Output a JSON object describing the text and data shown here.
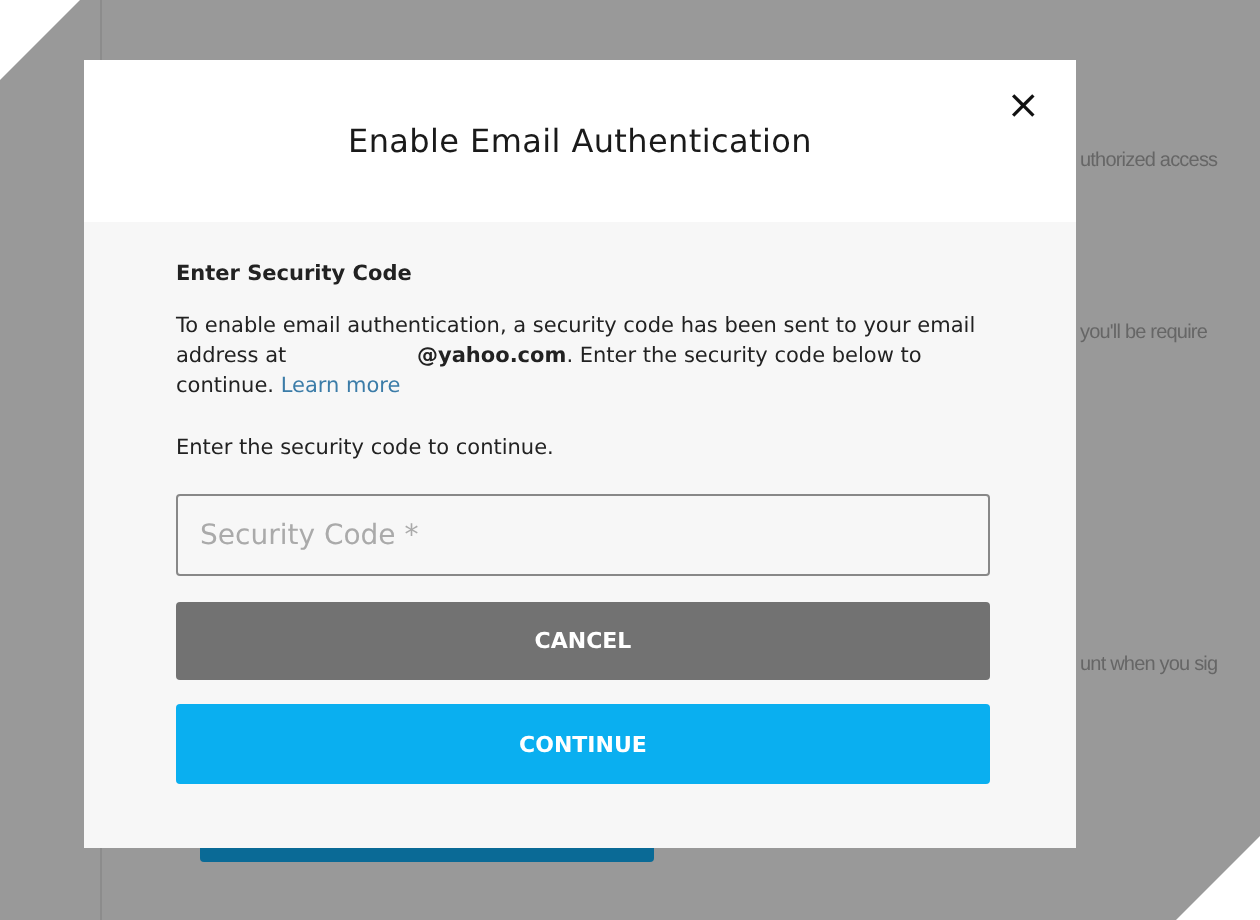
{
  "background": {
    "texts": [
      "uthorized access",
      "you'll be require",
      "unt when you sig"
    ]
  },
  "dialog": {
    "title": "Enable Email Authentication",
    "close": "×",
    "heading": "Enter Security Code",
    "message": {
      "before": "To enable email authentication, a security code has been sent to your email address at",
      "email": "@yahoo.com",
      "after": ". Enter the security code below to continue.",
      "link": "Learn more"
    },
    "prompt": "Enter the security code to continue.",
    "field": {
      "placeholder": "Security Code *"
    },
    "buttons": [
      {
        "label": "CANCEL",
        "kind": "secondary"
      },
      {
        "label": "CONTINUE",
        "kind": "primary"
      }
    ]
  }
}
